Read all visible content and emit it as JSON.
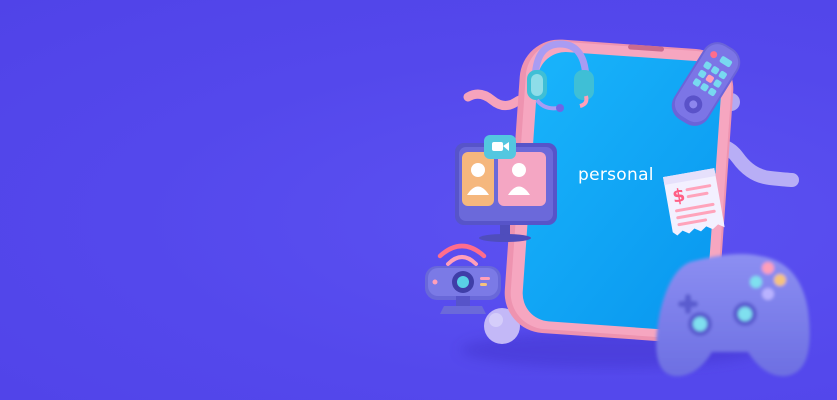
{
  "brand": {
    "wordmark": "personal"
  },
  "icons": [
    "smartphone-icon",
    "headset-icon",
    "remote-control-icon",
    "video-call-monitor-icon",
    "invoice-receipt-icon",
    "webcam-icon",
    "game-controller-icon"
  ],
  "colors": {
    "background": "#5549ee",
    "phone_screen": "#0ea4f6",
    "phone_frame": "#f19bb6",
    "accent_lavender": "#b3a9f2",
    "accent_pink": "#f5a0b7"
  }
}
